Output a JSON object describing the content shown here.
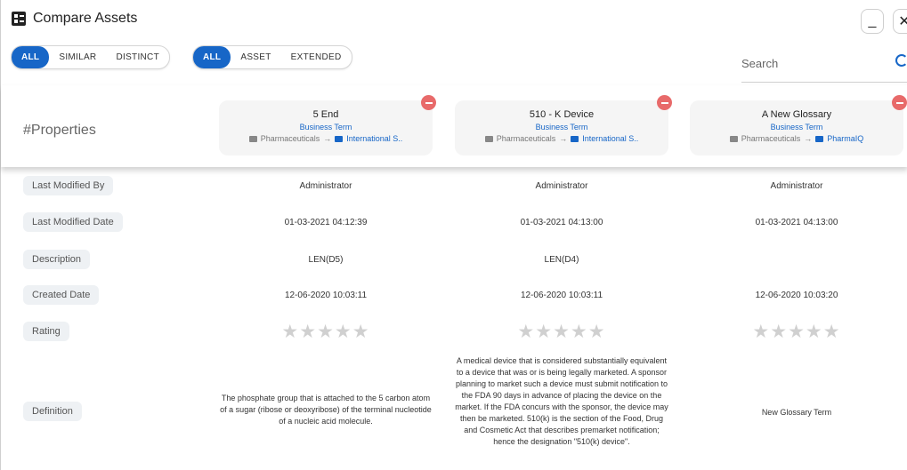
{
  "window": {
    "title": "Compare Assets",
    "minimize_label": "_",
    "close_label": "✕"
  },
  "filters": {
    "group1": [
      "ALL",
      "SIMILAR",
      "DISTINCT"
    ],
    "group2": [
      "ALL",
      "ASSET",
      "EXTENDED"
    ],
    "active_color": "#1766c7"
  },
  "search": {
    "placeholder": "Search"
  },
  "properties_label": "#Properties",
  "columns": [
    {
      "title": "5 End",
      "type": "Business Term",
      "path_root": "Pharmaceuticals",
      "path_leaf": "International S.."
    },
    {
      "title": "510 - K Device",
      "type": "Business Term",
      "path_root": "Pharmaceuticals",
      "path_leaf": "International S.."
    },
    {
      "title": "A New Glossary",
      "type": "Business Term",
      "path_root": "Pharmaceuticals",
      "path_leaf": "PharmaIQ"
    }
  ],
  "rows": [
    {
      "label": "Last Modified By",
      "values": [
        "Administrator",
        "Administrator",
        "Administrator"
      ]
    },
    {
      "label": "Last Modified Date",
      "values": [
        "01-03-2021 04:12:39",
        "01-03-2021 04:13:00",
        "01-03-2021 04:13:00"
      ]
    },
    {
      "label": "Description",
      "values": [
        "LEN(D5)",
        "LEN(D4)",
        ""
      ]
    },
    {
      "label": "Created Date",
      "values": [
        "12-06-2020 10:03:11",
        "12-06-2020 10:03:11",
        "12-06-2020 10:03:20"
      ]
    },
    {
      "label": "Rating",
      "values": [
        0,
        0,
        0
      ],
      "max": 5
    },
    {
      "label": "Definition",
      "values": [
        "The phosphate group that is attached to the 5 carbon atom of a sugar (ribose or deoxyribose) of the terminal nucleotide of a nucleic acid molecule.",
        "A medical device that is considered substantially equivalent to a device that was or is being legally marketed. A sponsor planning to market such a device must submit notification to the FDA 90 days in advance of placing the device on the market. If the FDA concurs with the sponsor, the device may then be marketed. 510(k) is the section of the Food, Drug and Cosmetic Act that describes premarket notification; hence the designation \"510(k) device\".",
        "New Glossary Term"
      ]
    }
  ],
  "star_glyph": "★★★★★",
  "arrow_glyph": "→"
}
